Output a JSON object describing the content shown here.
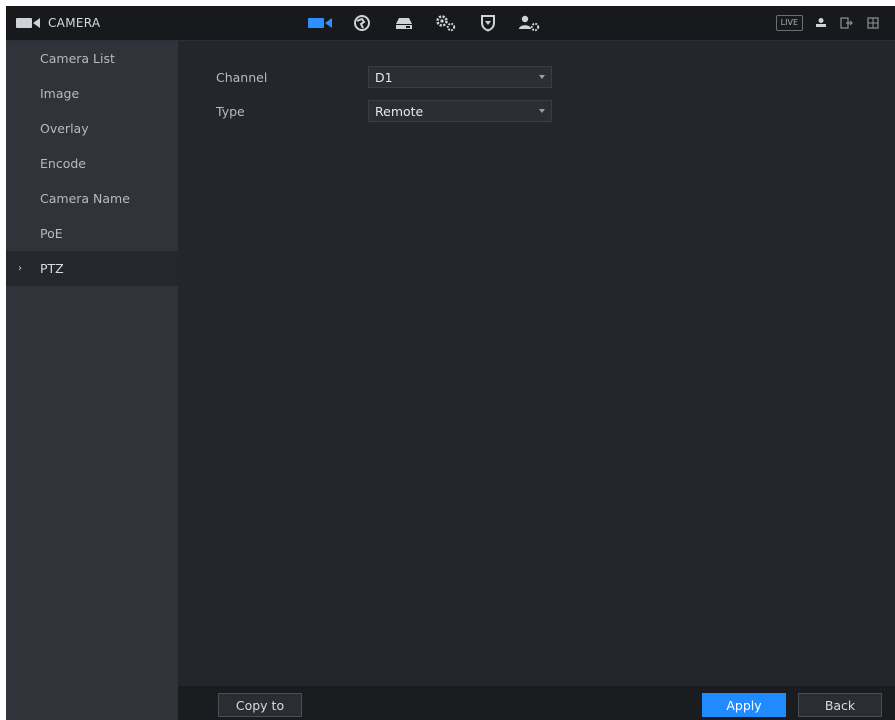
{
  "app": {
    "title": "CAMERA"
  },
  "topnav": {
    "items": [
      {
        "icon": "camera-icon",
        "active": true
      },
      {
        "icon": "network-icon",
        "active": false
      },
      {
        "icon": "storage-icon",
        "active": false
      },
      {
        "icon": "system-settings-icon",
        "active": false
      },
      {
        "icon": "security-shield-icon",
        "active": false
      },
      {
        "icon": "account-settings-icon",
        "active": false
      }
    ],
    "live_label": "LIVE"
  },
  "sidebar": {
    "items": [
      {
        "label": "Camera List"
      },
      {
        "label": "Image"
      },
      {
        "label": "Overlay"
      },
      {
        "label": "Encode"
      },
      {
        "label": "Camera Name"
      },
      {
        "label": "PoE"
      },
      {
        "label": "PTZ",
        "active": true
      }
    ]
  },
  "form": {
    "channel": {
      "label": "Channel",
      "value": "D1"
    },
    "type": {
      "label": "Type",
      "value": "Remote"
    }
  },
  "buttons": {
    "copy_to": "Copy to",
    "apply": "Apply",
    "back": "Back"
  },
  "colors": {
    "accent": "#1f8bff",
    "background": "#23262b",
    "sidebar": "#30333a"
  }
}
